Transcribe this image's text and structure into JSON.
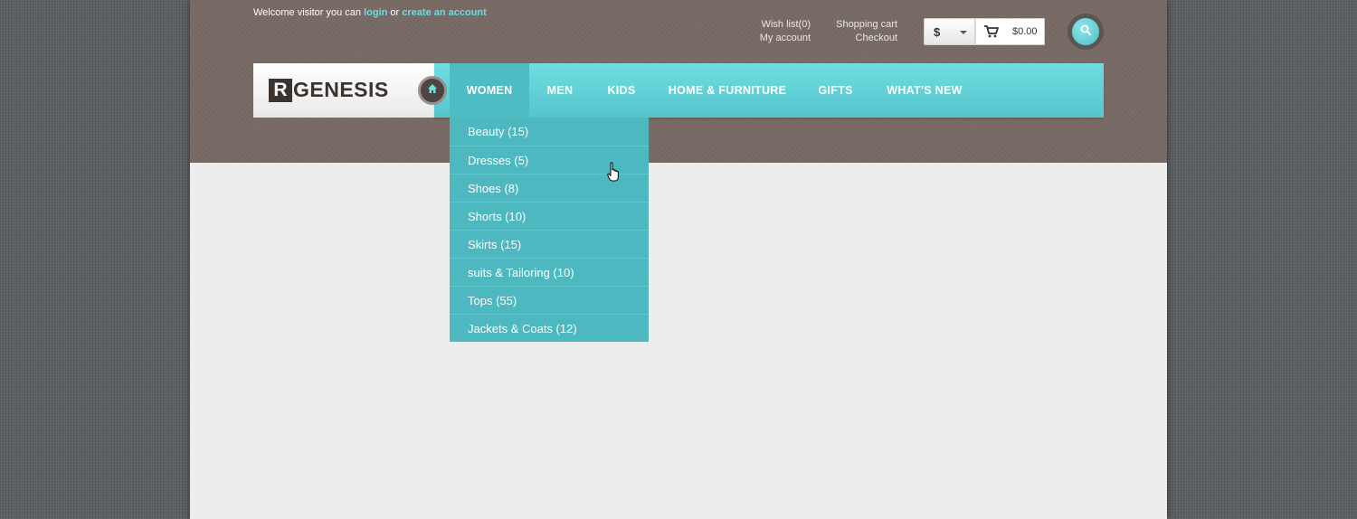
{
  "header": {
    "welcome_text": "Welcome visitor you can",
    "login_link": "login",
    "or_text": "or",
    "create_account_link": "create an account",
    "wishlist": "Wish list(0)",
    "my_account": "My account",
    "shopping_cart": "Shopping cart",
    "checkout": "Checkout",
    "currency": "$",
    "cart_total": "$0.00"
  },
  "logo": {
    "mark": "R",
    "text": "GENESIS"
  },
  "nav": {
    "items": [
      {
        "label": "Women"
      },
      {
        "label": "Men"
      },
      {
        "label": "Kids"
      },
      {
        "label": "Home & Furniture"
      },
      {
        "label": "Gifts"
      },
      {
        "label": "What's New"
      }
    ]
  },
  "dropdown": {
    "items": [
      {
        "label": "Beauty (15)"
      },
      {
        "label": "Dresses (5)"
      },
      {
        "label": "Shoes (8)"
      },
      {
        "label": "Shorts (10)"
      },
      {
        "label": "Skirts (15)"
      },
      {
        "label": "suits & Tailoring (10)"
      },
      {
        "label": "Tops (55)"
      },
      {
        "label": "Jackets & Coats (12)"
      }
    ]
  },
  "colors": {
    "accent": "#5fd3d8",
    "header_bg": "#786a64",
    "page_bg": "#ededed"
  }
}
